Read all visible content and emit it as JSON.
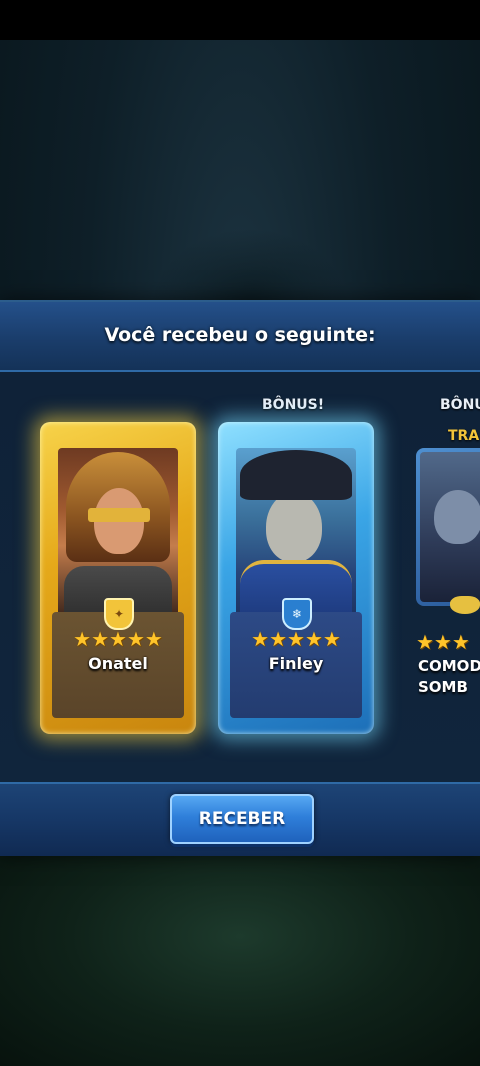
{
  "dialog": {
    "title": "Você recebeu o seguinte:"
  },
  "rewards": [
    {
      "name": "Onatel",
      "stars": "★★★★★",
      "rarity": "legendary",
      "frame_color": "#e5a91a",
      "emblem_icon": "holy-emblem-icon",
      "bonus_label": ""
    },
    {
      "name": "Finley",
      "stars": "★★★★★",
      "rarity": "legendary",
      "frame_color": "#3aa5e6",
      "emblem_icon": "ice-emblem-icon",
      "bonus_label": "BÔNUS!"
    },
    {
      "name_line1": "COMOD",
      "name_line2": "SOMB",
      "stars": "★★★",
      "bonus_label": "BÔNU",
      "tag_label": "TRA",
      "emblem_icon": "mask-icon"
    }
  ],
  "footer": {
    "receive_label": "RECEBER"
  },
  "colors": {
    "accent_gold": "#ffc42a",
    "button_blue": "#2f7fda",
    "panel_blue": "#1a3d6b"
  }
}
